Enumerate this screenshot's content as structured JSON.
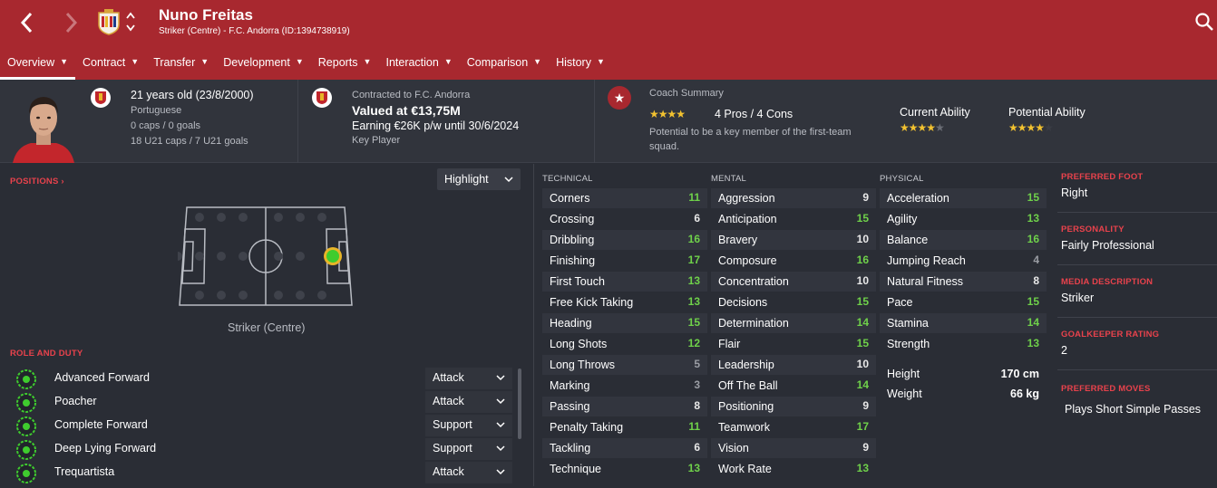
{
  "header": {
    "player_name": "Nuno Freitas",
    "player_sub": "Striker (Centre) - F.C. Andorra (ID:1394738919)",
    "accent_color": "#a8282f"
  },
  "menu": [
    {
      "label": "Overview",
      "active": true
    },
    {
      "label": "Contract"
    },
    {
      "label": "Transfer"
    },
    {
      "label": "Development"
    },
    {
      "label": "Reports"
    },
    {
      "label": "Interaction"
    },
    {
      "label": "Comparison"
    },
    {
      "label": "History"
    }
  ],
  "info": {
    "age": "21 years old (23/8/2000)",
    "nationality": "Portuguese",
    "caps": "0 caps / 0 goals",
    "u21_caps": "18 U21 caps / 7 U21 goals",
    "contracted": "Contracted to F.C. Andorra",
    "valued": "Valued at €13,75M",
    "earning": "Earning €26K p/w until 30/6/2024",
    "status": "Key Player",
    "coach_title": "Coach Summary",
    "coach_pros_cons": "4 Pros / 4 Cons",
    "coach_stars": 4,
    "coach_desc": "Potential to be a key member of the first-team squad.",
    "current_ability_label": "Current Ability",
    "current_ability_stars": 4,
    "potential_ability_label": "Potential Ability",
    "potential_ability_stars": 4
  },
  "positions": {
    "title": "POSITIONS",
    "highlight": "Highlight",
    "position_label": "Striker (Centre)"
  },
  "roles": {
    "title": "ROLE AND DUTY",
    "items": [
      {
        "name": "Advanced Forward",
        "duty": "Attack"
      },
      {
        "name": "Poacher",
        "duty": "Attack"
      },
      {
        "name": "Complete Forward",
        "duty": "Support"
      },
      {
        "name": "Deep Lying Forward",
        "duty": "Support"
      },
      {
        "name": "Trequartista",
        "duty": "Attack"
      }
    ]
  },
  "technical": {
    "title": "TECHNICAL",
    "items": [
      {
        "name": "Corners",
        "value": "11"
      },
      {
        "name": "Crossing",
        "value": "6"
      },
      {
        "name": "Dribbling",
        "value": "16"
      },
      {
        "name": "Finishing",
        "value": "17"
      },
      {
        "name": "First Touch",
        "value": "13"
      },
      {
        "name": "Free Kick Taking",
        "value": "13"
      },
      {
        "name": "Heading",
        "value": "15"
      },
      {
        "name": "Long Shots",
        "value": "12"
      },
      {
        "name": "Long Throws",
        "value": "5"
      },
      {
        "name": "Marking",
        "value": "3"
      },
      {
        "name": "Passing",
        "value": "8"
      },
      {
        "name": "Penalty Taking",
        "value": "11"
      },
      {
        "name": "Tackling",
        "value": "6"
      },
      {
        "name": "Technique",
        "value": "13"
      }
    ]
  },
  "mental": {
    "title": "MENTAL",
    "items": [
      {
        "name": "Aggression",
        "value": "9"
      },
      {
        "name": "Anticipation",
        "value": "15"
      },
      {
        "name": "Bravery",
        "value": "10"
      },
      {
        "name": "Composure",
        "value": "16"
      },
      {
        "name": "Concentration",
        "value": "10"
      },
      {
        "name": "Decisions",
        "value": "15"
      },
      {
        "name": "Determination",
        "value": "14"
      },
      {
        "name": "Flair",
        "value": "15"
      },
      {
        "name": "Leadership",
        "value": "10"
      },
      {
        "name": "Off The Ball",
        "value": "14"
      },
      {
        "name": "Positioning",
        "value": "9"
      },
      {
        "name": "Teamwork",
        "value": "17"
      },
      {
        "name": "Vision",
        "value": "9"
      },
      {
        "name": "Work Rate",
        "value": "13"
      }
    ]
  },
  "physical": {
    "title": "PHYSICAL",
    "items": [
      {
        "name": "Acceleration",
        "value": "15"
      },
      {
        "name": "Agility",
        "value": "13"
      },
      {
        "name": "Balance",
        "value": "16"
      },
      {
        "name": "Jumping Reach",
        "value": "4"
      },
      {
        "name": "Natural Fitness",
        "value": "8"
      },
      {
        "name": "Pace",
        "value": "15"
      },
      {
        "name": "Stamina",
        "value": "14"
      },
      {
        "name": "Strength",
        "value": "13"
      }
    ],
    "height_label": "Height",
    "height_value": "170 cm",
    "weight_label": "Weight",
    "weight_value": "66 kg"
  },
  "side": {
    "preferred_foot_label": "PREFERRED FOOT",
    "preferred_foot": "Right",
    "personality_label": "PERSONALITY",
    "personality": "Fairly Professional",
    "media_label": "MEDIA DESCRIPTION",
    "media": "Striker",
    "gk_label": "GOALKEEPER RATING",
    "gk": "2",
    "moves_label": "PREFERRED MOVES",
    "moves": "Plays Short Simple Passes"
  }
}
